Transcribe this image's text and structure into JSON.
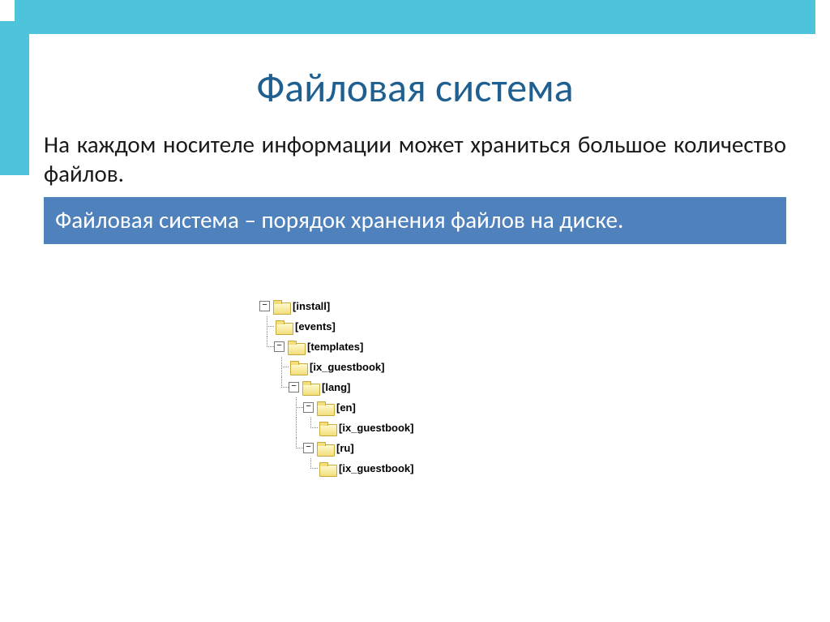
{
  "title": "Файловая система",
  "intro": "На каждом носителе информации может храниться большое количество файлов.",
  "definition": "Файловая система – порядок хранения файлов на диске.",
  "tree": {
    "n0": "[install]",
    "n1": "[events]",
    "n2": "[templates]",
    "n3": "[ix_guestbook]",
    "n4": "[lang]",
    "n5": "[en]",
    "n6": "[ix_guestbook]",
    "n7": "[ru]",
    "n8": "[ix_guestbook]"
  },
  "icons": {
    "minus": "−"
  }
}
